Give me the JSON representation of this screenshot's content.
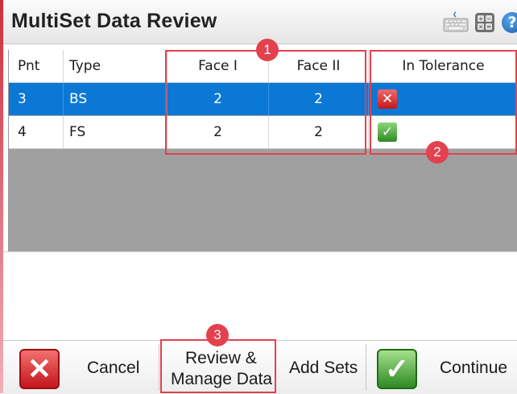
{
  "window": {
    "title": "MultiSet Data Review"
  },
  "toolbar": {
    "keyboard_icon": "keyboard-icon",
    "calculator_icon": "calculator-icon",
    "help_icon": "help-icon",
    "help_glyph": "?"
  },
  "table": {
    "columns": [
      "Pnt",
      "Type",
      "Face I",
      "Face II",
      "In Tolerance"
    ],
    "rows": [
      {
        "pnt": "3",
        "type": "BS",
        "face1": "2",
        "face2": "2",
        "in_tolerance": "fail",
        "selected": true
      },
      {
        "pnt": "4",
        "type": "FS",
        "face1": "2",
        "face2": "2",
        "in_tolerance": "pass",
        "selected": false
      }
    ],
    "selected_color": "#0a78d4"
  },
  "annotations": {
    "badge1": "1",
    "badge2": "2",
    "badge3": "3",
    "color": "#e3414e"
  },
  "buttons": {
    "cancel": "Cancel",
    "review_line1": "Review &",
    "review_line2": "Manage Data",
    "add_sets": "Add Sets",
    "continue": "Continue"
  },
  "icons": {
    "cancel_glyph": "✕",
    "continue_glyph": "✓"
  }
}
